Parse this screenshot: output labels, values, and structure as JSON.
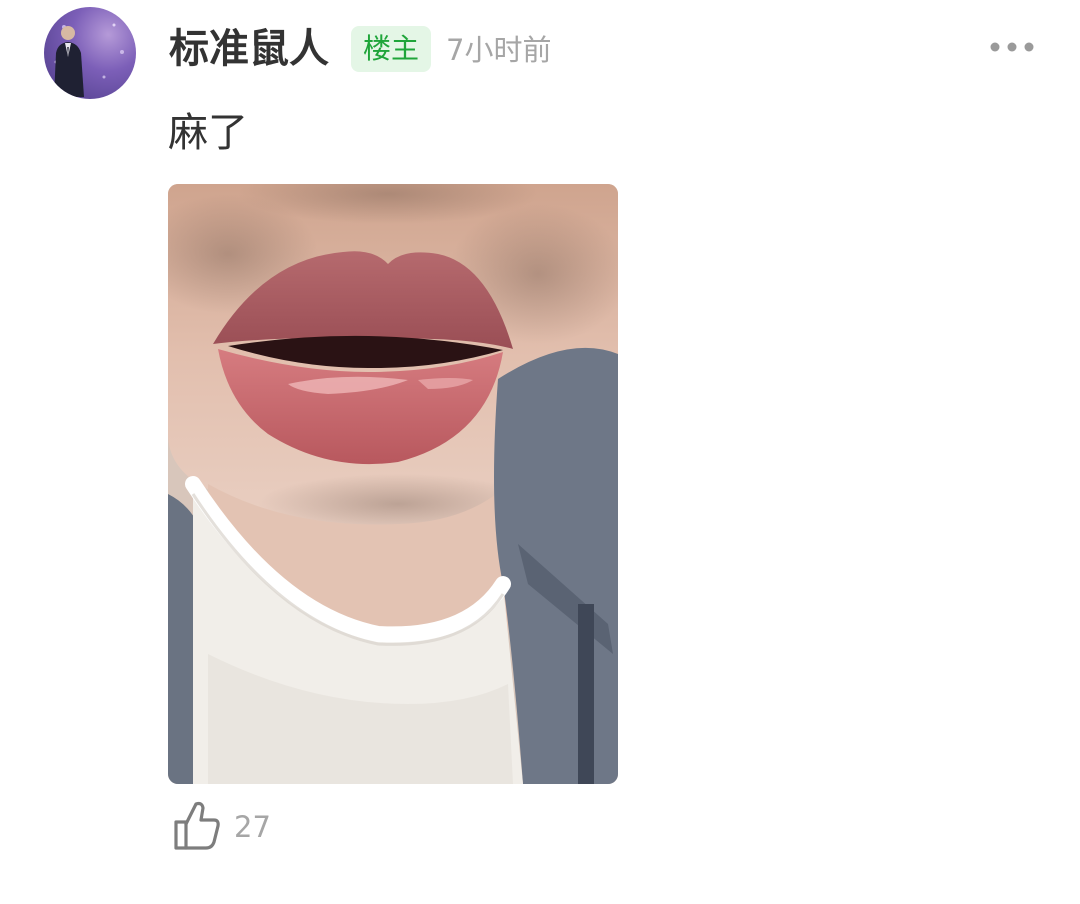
{
  "comment": {
    "author": {
      "name": "标准鼠人",
      "avatar_icon": "user-avatar-image"
    },
    "badge": "楼主",
    "time": "7小时前",
    "more_icon": "more-dots-icon",
    "text": "麻了",
    "image": {
      "subject": "photo-close-up-swollen-lips"
    },
    "likes": {
      "icon": "thumbs-up-icon",
      "count": "27"
    }
  },
  "colors": {
    "badge_background": "#e4f6e6",
    "badge_text": "#1fa53a",
    "secondary_text": "#a6a6a6",
    "primary_text": "#333333"
  }
}
